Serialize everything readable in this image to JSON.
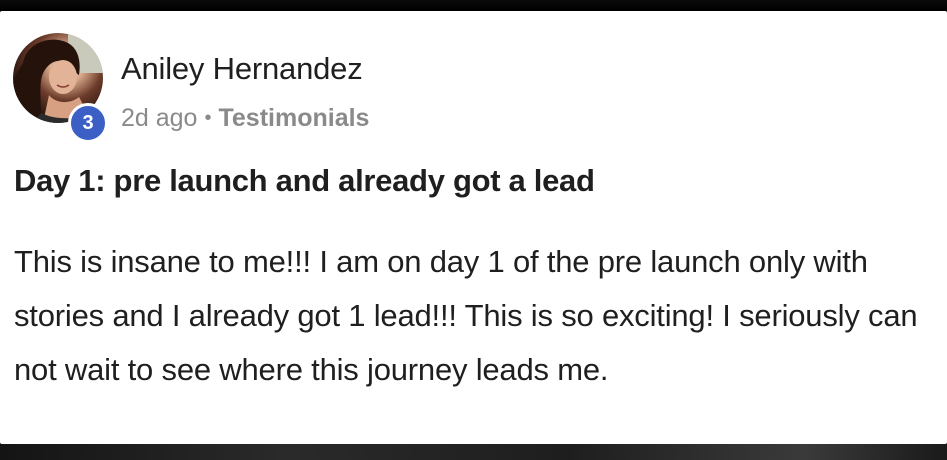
{
  "post": {
    "author": {
      "name": "Aniley Hernandez",
      "level": "3",
      "avatar_icon": "user-avatar-photo"
    },
    "meta": {
      "time_ago": "2d ago",
      "separator": "•",
      "category": "Testimonials"
    },
    "title": "Day 1: pre launch and already got a lead",
    "body": "This is insane to me!!! I am on day 1 of the pre launch only with stories and I already got 1 lead!!! This is so exciting! I seriously can not wait to see where this journey leads me."
  },
  "colors": {
    "card_background": "#ffffff",
    "text_primary": "#1f1f1f",
    "text_secondary": "#8a8a8a",
    "badge_blue": "#3b5fc4"
  }
}
